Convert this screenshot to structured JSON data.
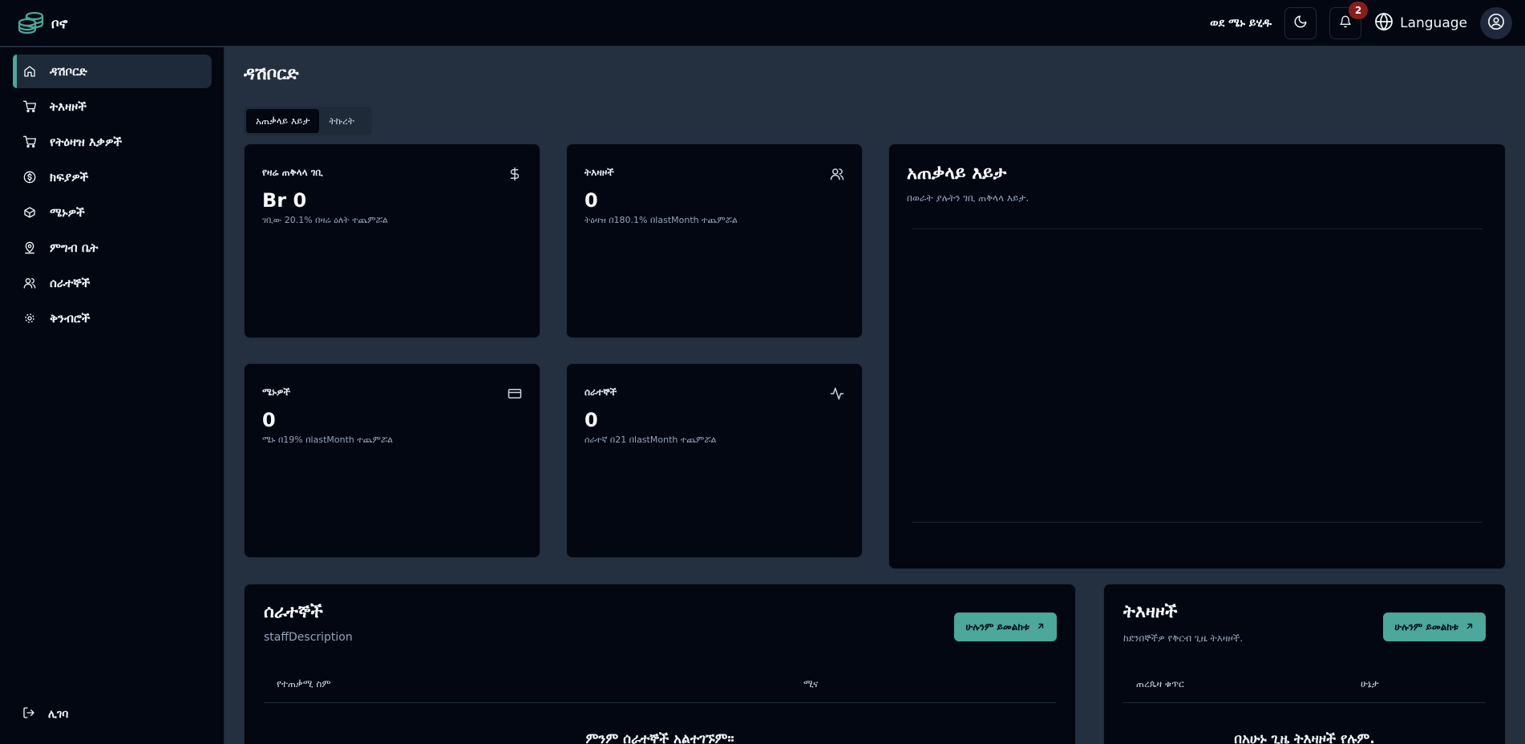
{
  "brand": {
    "name": "ቦኖ",
    "icon": "coins-stack-icon"
  },
  "topbar": {
    "goto_label": "ወደ ሜኑ ይሂዱ",
    "notification_count": "2",
    "language_label": "Language"
  },
  "sidebar": {
    "items": [
      {
        "label": "ዳሽቦርድ",
        "icon": "home-icon",
        "active": true
      },
      {
        "label": "ትእዛዞች",
        "icon": "cart-icon"
      },
      {
        "label": "የትዕዛዝ እቃዎች",
        "icon": "cart-icon"
      },
      {
        "label": "ክፍያዎች",
        "icon": "dollar-circle-icon"
      },
      {
        "label": "ሜኑዎች",
        "icon": "box-icon"
      },
      {
        "label": "ምግብ ቤት",
        "icon": "map-pin-icon"
      },
      {
        "label": "ሰራተኞች",
        "icon": "users-icon"
      },
      {
        "label": "ቅንብሮች",
        "icon": "gear-icon"
      }
    ],
    "logout_label": "ሊገባ"
  },
  "main": {
    "title": "ዳሽቦርድ",
    "tabs": [
      {
        "label": "አጠቃላይ እይታ"
      },
      {
        "label": "ትኩረት"
      }
    ],
    "stats": [
      {
        "title": "የዛሬ ጠቅላላ ገቢ",
        "value": "Br 0",
        "sub": "ገቢው 20.1% በዛሬ ዕለት ተጨምሯል",
        "icon": "dollar-icon"
      },
      {
        "title": "ትእዛዞች",
        "value": "0",
        "sub": "ትዕዛዝ በ180.1% በlastMonth ተጨምሯል",
        "icon": "users-icon"
      },
      {
        "title": "ሜኑዎች",
        "value": "0",
        "sub": "ሜኑ በ19% በlastMonth ተጨምሯል",
        "icon": "credit-card-icon"
      },
      {
        "title": "ሰራተኞች",
        "value": "0",
        "sub": "ሰራተኛ በ21 በlastMonth ተጨምሯል",
        "icon": "activity-icon"
      }
    ],
    "overview": {
      "title": "አጠቃላይ እይታ",
      "subtitle": "በወራት ያሉትን ገቢ ጠቅላላ እይታ."
    },
    "staff": {
      "title": "ሰራተኞች",
      "subtitle": "staffDescription",
      "view_all": "ሁሉንም ይመልከቱ",
      "columns": [
        "የተጠቃሚ ስም",
        "ሚና"
      ],
      "empty": "ምንም ሰራተኞች አልተገኙም።"
    },
    "orders": {
      "title": "ትእዛዞች",
      "subtitle": "ከደንበኞችዎ የቅርብ ጊዜ ትእዛዞች.",
      "view_all": "ሁሉንም ይመልከቱ",
      "columns": [
        "ጠረጴዛ ቁጥር",
        "ሁኔታ"
      ],
      "empty": "በአሁኑ ጊዜ ትእዛዞች የሉም."
    }
  },
  "colors": {
    "accent": "#4ba89b",
    "badge": "#8b1c1c",
    "background": "#030712",
    "content_bg": "#243040"
  }
}
